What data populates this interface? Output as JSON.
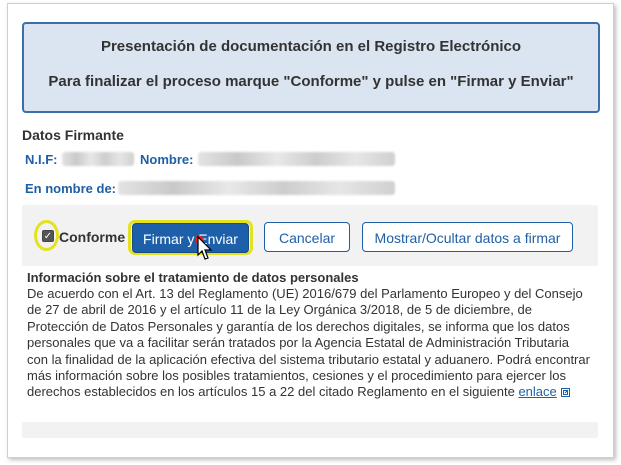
{
  "header": {
    "title": "Presentación de documentación en el Registro Electrónico",
    "instruction": "Para finalizar el proceso marque \"Conforme\" y pulse en \"Firmar y Enviar\""
  },
  "signer": {
    "section_title": "Datos Firmante",
    "nif_label": "N.I.F:",
    "name_label": "Nombre:",
    "on_behalf_label": "En nombre de:"
  },
  "actions": {
    "conforme_label": "Conforme",
    "conforme_checked": true,
    "sign_send_label": "Firmar y Enviar",
    "cancel_label": "Cancelar",
    "toggle_data_label": "Mostrar/Ocultar datos a firmar"
  },
  "privacy": {
    "title": "Información sobre el tratamiento de datos personales",
    "body": "De acuerdo con el Art. 13 del Reglamento (UE) 2016/679 del Parlamento Europeo y del Consejo de 27 de abril de 2016 y el artículo 11 de la Ley Orgánica 3/2018, de 5 de diciembre, de Protección de Datos Personales y garantía de los derechos digitales, se informa que los datos personales que va a facilitar serán tratados por la Agencia Estatal de Administración Tributaria con la finalidad de la aplicación efectiva del sistema tributario estatal y aduanero. Podrá encontrar más información sobre los posibles tratamientos, cesiones y el procedimiento para ejercer los derechos establecidos en los artículos 15 a 22 del citado Reglamento en el siguiente",
    "link_label": "enlace",
    "link_icon": "external-link-icon"
  },
  "colors": {
    "header_bg": "#dbe5f1",
    "header_border": "#3b6fa8",
    "label_blue": "#1f5fa5",
    "primary_button": "#1d5fa8",
    "highlight_ring": "#e4e21f",
    "panel_bg": "#f2f2f2"
  }
}
